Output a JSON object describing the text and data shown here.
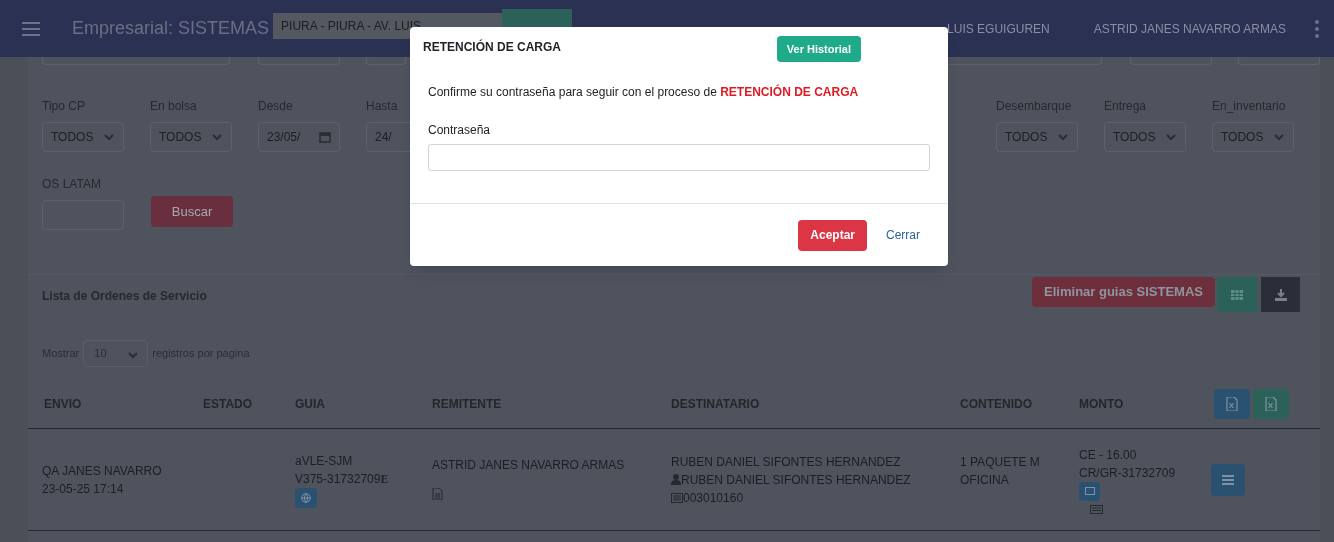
{
  "header": {
    "title": "Empresarial: SISTEMAS",
    "branch_select": "PIURA - PIURA - AV. LUIS",
    "location": "LUIS EGUIGUREN",
    "user": "ASTRID JANES NAVARRO ARMAS"
  },
  "filters": {
    "left": [
      {
        "label": "Tipo CP",
        "kind": "select",
        "value": "TODOS"
      },
      {
        "label": "En bolsa",
        "kind": "select",
        "value": "TODOS"
      },
      {
        "label": "Desde",
        "kind": "date",
        "value": "23/05/"
      },
      {
        "label": "Hasta",
        "kind": "date",
        "value": "24/"
      }
    ],
    "right": [
      {
        "label": "Desembarque",
        "kind": "select",
        "value": "TODOS"
      },
      {
        "label": "Entrega",
        "kind": "select",
        "value": "TODOS"
      },
      {
        "label": "En_inventario",
        "kind": "select",
        "value": "TODOS"
      }
    ],
    "os_label": "OS LATAM",
    "search_button": "Buscar"
  },
  "list": {
    "title": "Lista de Ordenes de Servicio",
    "delete_button": "Eliminar guias SISTEMAS",
    "show_label": "Mostrar",
    "page_size": "10",
    "per_page_label": "registros por pagina",
    "columns": [
      "ENVIO",
      "ESTADO",
      "GUIA",
      "REMITENTE",
      "DESTINATARIO",
      "CONTENIDO",
      "MONTO"
    ],
    "rows": [
      {
        "envio": [
          "QA JANES NAVARRO",
          "23-05-25 17:14"
        ],
        "guia": [
          "aVLE-SJM",
          "V375-31732709"
        ],
        "guia_mark": "E",
        "remitente": "ASTRID JANES NAVARRO ARMAS",
        "destinatario": "RUBEN DANIEL SIFONTES HERNANDEZ",
        "contact": "RUBEN DANIEL SIFONTES HERNANDEZ",
        "document": "003010160",
        "contenido": [
          "1 PAQUETE M",
          "OFICINA"
        ],
        "monto": [
          "CE - 16.00",
          "CR/GR-31732709"
        ]
      }
    ]
  },
  "modal": {
    "title": "RETENCIÓN DE CARGA",
    "history_button": "Ver Historial",
    "message": "Confirme su contraseña para seguir con el proceso de **RETENCIÓN DE CARGA**",
    "password_label": "Contraseña",
    "accept_button": "Aceptar",
    "close_link": "Cerrar"
  }
}
